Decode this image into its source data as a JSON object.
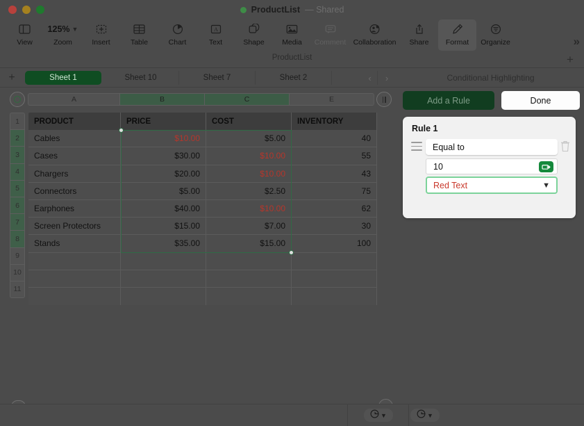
{
  "window": {
    "title": "ProductList",
    "shared_label": "— Shared",
    "traffic_lights": [
      "close",
      "minimize",
      "zoom"
    ]
  },
  "toolbar": {
    "items": [
      {
        "label": "View",
        "icon": "view-sidebar-icon",
        "state": "normal"
      },
      {
        "label": "Zoom",
        "icon": "zoom-icon",
        "state": "normal",
        "value": "125%"
      },
      {
        "label": "Insert",
        "icon": "insert-icon",
        "state": "normal"
      },
      {
        "label": "Table",
        "icon": "table-icon",
        "state": "normal"
      },
      {
        "label": "Chart",
        "icon": "chart-icon",
        "state": "normal"
      },
      {
        "label": "Text",
        "icon": "text-icon",
        "state": "normal"
      },
      {
        "label": "Shape",
        "icon": "shape-icon",
        "state": "normal"
      },
      {
        "label": "Media",
        "icon": "media-icon",
        "state": "normal"
      },
      {
        "label": "Comment",
        "icon": "comment-icon",
        "state": "disabled"
      },
      {
        "label": "Collaboration",
        "icon": "collaboration-icon",
        "state": "normal"
      },
      {
        "label": "Share",
        "icon": "share-icon",
        "state": "normal"
      },
      {
        "label": "Format",
        "icon": "format-brush-icon",
        "state": "active"
      },
      {
        "label": "Organize",
        "icon": "organize-icon",
        "state": "normal"
      }
    ],
    "overflow_label": "»"
  },
  "doc_strip": {
    "name": "ProductList",
    "add_label": "+"
  },
  "sheet_tabs": {
    "add_label": "+",
    "tabs": [
      {
        "label": "Sheet 1",
        "active": true
      },
      {
        "label": "Sheet 10",
        "active": false
      },
      {
        "label": "Sheet 7",
        "active": false
      },
      {
        "label": "Sheet 2",
        "active": false
      }
    ],
    "prev_label": "‹",
    "next_label": "›"
  },
  "spreadsheet": {
    "column_headers": [
      {
        "label": "A",
        "selected": false
      },
      {
        "label": "B",
        "selected": true
      },
      {
        "label": "C",
        "selected": true
      },
      {
        "label": "E",
        "selected": false
      }
    ],
    "row_headers": [
      {
        "label": "1",
        "selected": false
      },
      {
        "label": "2",
        "selected": true
      },
      {
        "label": "3",
        "selected": true
      },
      {
        "label": "4",
        "selected": true
      },
      {
        "label": "5",
        "selected": true
      },
      {
        "label": "6",
        "selected": true
      },
      {
        "label": "7",
        "selected": true
      },
      {
        "label": "8",
        "selected": true
      },
      {
        "label": "9",
        "selected": false
      },
      {
        "label": "10",
        "selected": false
      },
      {
        "label": "11",
        "selected": false
      }
    ],
    "header_row": [
      "PRODUCT",
      "PRICE",
      "COST",
      "INVENTORY"
    ],
    "rows": [
      {
        "product": "Cables",
        "price": "$10.00",
        "price_red": true,
        "cost": "$5.00",
        "cost_red": false,
        "inventory": "40"
      },
      {
        "product": "Cases",
        "price": "$30.00",
        "price_red": false,
        "cost": "$10.00",
        "cost_red": true,
        "inventory": "55"
      },
      {
        "product": "Chargers",
        "price": "$20.00",
        "price_red": false,
        "cost": "$10.00",
        "cost_red": true,
        "inventory": "43"
      },
      {
        "product": "Connectors",
        "price": "$5.00",
        "price_red": false,
        "cost": "$2.50",
        "cost_red": false,
        "inventory": "75"
      },
      {
        "product": "Earphones",
        "price": "$40.00",
        "price_red": false,
        "cost": "$10.00",
        "cost_red": true,
        "inventory": "62"
      },
      {
        "product": "Screen Protectors",
        "price": "$15.00",
        "price_red": false,
        "cost": "$7.00",
        "cost_red": false,
        "inventory": "30"
      },
      {
        "product": "Stands",
        "price": "$35.00",
        "price_red": false,
        "cost": "$15.00",
        "cost_red": false,
        "inventory": "100"
      },
      {
        "product": "",
        "price": "",
        "price_red": false,
        "cost": "",
        "cost_red": false,
        "inventory": ""
      },
      {
        "product": "",
        "price": "",
        "price_red": false,
        "cost": "",
        "cost_red": false,
        "inventory": ""
      },
      {
        "product": "",
        "price": "",
        "price_red": false,
        "cost": "",
        "cost_red": false,
        "inventory": ""
      }
    ],
    "selection_range": "B2:C8"
  },
  "panel": {
    "title": "Conditional Highlighting",
    "add_rule_label": "Add a Rule",
    "done_label": "Done",
    "rule": {
      "title": "Rule 1",
      "condition": "Equal to",
      "value": "10",
      "style": "Red Text",
      "style_color": "#c9382b",
      "highlight_color": "#7cd39a"
    }
  },
  "colors": {
    "accent_green": "#0f4d22",
    "selection_green": "#2f6b45",
    "red_text": "#b5362b",
    "window_bg": "#4b4b4b"
  }
}
